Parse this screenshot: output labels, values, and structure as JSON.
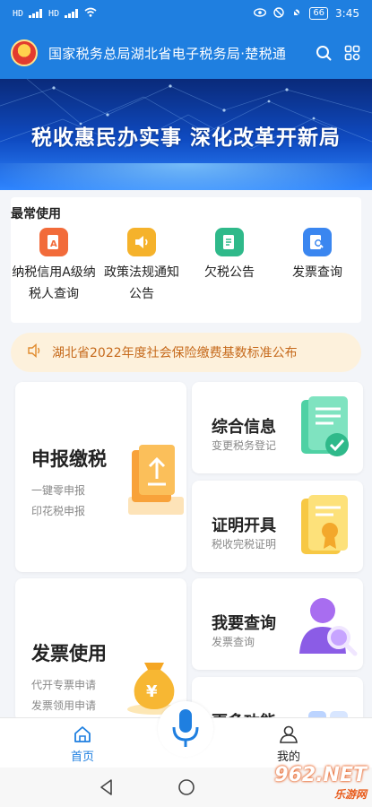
{
  "status": {
    "left_tags": [
      "HD",
      "HD"
    ],
    "time": "3:45",
    "battery": "66"
  },
  "header": {
    "title": "国家税务总局湖北省电子税务局·楚税通"
  },
  "banner": {
    "text": "税收惠民办实事  深化改革开新局"
  },
  "frequent": {
    "title": "最常使用",
    "items": [
      {
        "label": "纳税信用A级纳税人查询",
        "icon": "credit-doc-icon",
        "color": "#f26b3a"
      },
      {
        "label": "政策法规通知公告",
        "icon": "speaker-icon",
        "color": "#f5b22b"
      },
      {
        "label": "欠税公告",
        "icon": "announcement-icon",
        "color": "#2fb98a"
      },
      {
        "label": "发票查询",
        "icon": "invoice-search-icon",
        "color": "#3a86f0"
      }
    ]
  },
  "notice": {
    "text": "湖北省2022年度社会保险缴费基数标准公布"
  },
  "cards": {
    "declare": {
      "title": "申报缴税",
      "subs": [
        "一键零申报",
        "印花税申报"
      ]
    },
    "info": {
      "title": "综合信息",
      "subs": [
        "变更税务登记"
      ]
    },
    "cert": {
      "title": "证明开具",
      "subs": [
        "税收完税证明"
      ]
    },
    "invoice": {
      "title": "发票使用",
      "subs": [
        "代开专票申请",
        "发票领用申请"
      ]
    },
    "query": {
      "title": "我要查询",
      "subs": [
        "发票查询"
      ]
    },
    "more": {
      "title": "更多功能"
    }
  },
  "bottom_nav": {
    "home": "首页",
    "mine": "我的"
  },
  "watermark": {
    "brand": "962.NET",
    "sub": "乐游网"
  },
  "colors": {
    "primary": "#1f7fe0",
    "notice_bg": "#fdf1dc",
    "notice_text": "#c66a1c"
  }
}
